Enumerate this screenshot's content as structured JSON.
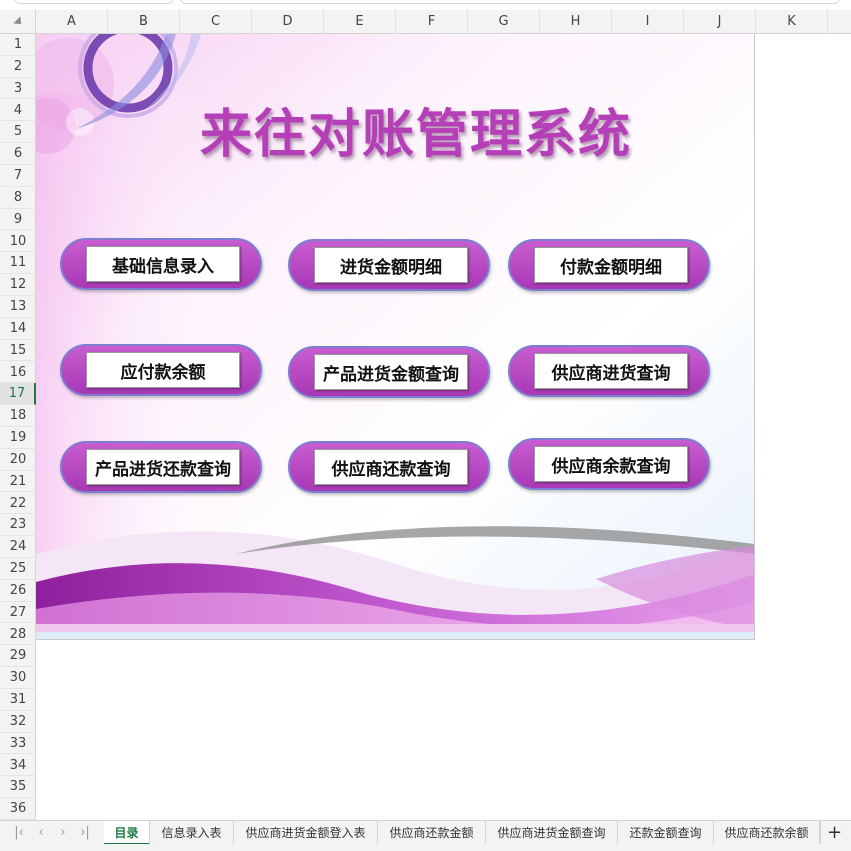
{
  "sheet": {
    "columns": [
      "A",
      "B",
      "C",
      "D",
      "E",
      "F",
      "G",
      "H",
      "I",
      "J",
      "K"
    ],
    "rows": [
      "1",
      "2",
      "3",
      "4",
      "5",
      "6",
      "7",
      "8",
      "9",
      "10",
      "11",
      "12",
      "13",
      "14",
      "15",
      "16",
      "17",
      "18",
      "19",
      "20",
      "21",
      "22",
      "23",
      "24",
      "25",
      "26",
      "27",
      "28",
      "29",
      "30",
      "31",
      "32",
      "33",
      "34",
      "35",
      "36"
    ],
    "active_row": "17"
  },
  "dashboard": {
    "title": "来往对账管理系统",
    "buttons": [
      {
        "label": "基础信息录入"
      },
      {
        "label": "进货金额明细"
      },
      {
        "label": "付款金额明细"
      },
      {
        "label": "应付款余额"
      },
      {
        "label": "产品进货金额查询"
      },
      {
        "label": "供应商进货查询"
      },
      {
        "label": "产品进货还款查询"
      },
      {
        "label": "供应商还款查询"
      },
      {
        "label": "供应商余款查询"
      }
    ],
    "colors": {
      "accent": "#b53fb7",
      "button_fill": "#bf4fc8",
      "button_border": "#7e7ed0"
    }
  },
  "tabs": {
    "nav_icons": [
      "first-sheet-icon",
      "prev-sheet-icon",
      "next-sheet-icon",
      "last-sheet-icon"
    ],
    "items": [
      {
        "label": "目录",
        "active": true
      },
      {
        "label": "信息录入表"
      },
      {
        "label": "供应商进货金额登入表"
      },
      {
        "label": "供应商还款金额"
      },
      {
        "label": "供应商进货金额查询"
      },
      {
        "label": "还款金额查询"
      },
      {
        "label": "供应商还款余额"
      }
    ],
    "add_label": "+",
    "active_color": "#1d7a45"
  }
}
